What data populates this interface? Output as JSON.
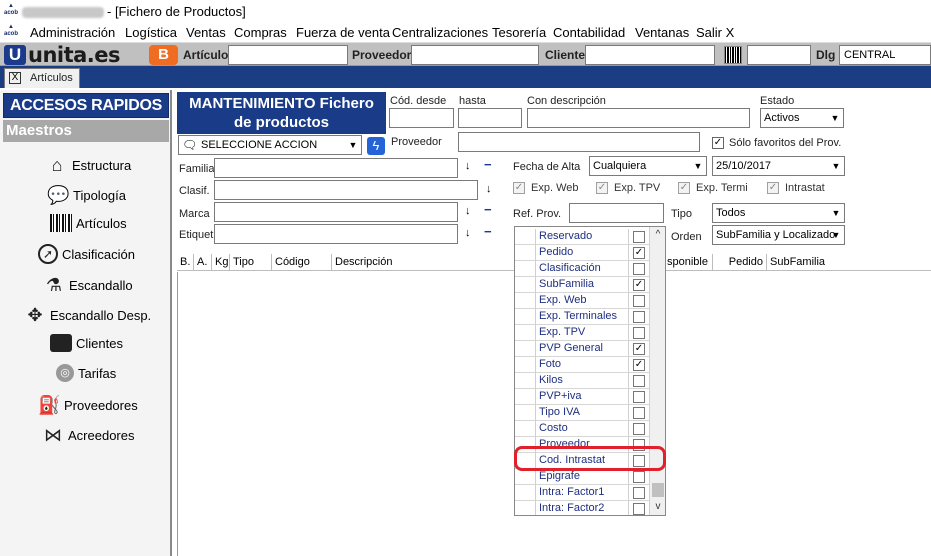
{
  "window": {
    "title": "- [Fichero de Productos]",
    "icon_text": "acob"
  },
  "menu": [
    "Administración",
    "Logística",
    "Ventas",
    "Compras",
    "Fuerza de venta",
    "Centralizaciones",
    "Tesorería",
    "Contabilidad",
    "Ventanas",
    "Salir X"
  ],
  "toolbar": {
    "logo": "unita.es",
    "logo_u": "U",
    "logo_b": "B",
    "articulo_label": "Artículo",
    "articulo_value": "",
    "proveedor_label": "Proveedor",
    "proveedor_value": "",
    "cliente_label": "Cliente",
    "cliente_value": "",
    "barcode_value": "",
    "dlg_label": "Dlg",
    "dlg_value": "CENTRAL"
  },
  "tabs": [
    {
      "label": "Artículos",
      "close": "X"
    }
  ],
  "sidebar": {
    "header": "ACCESOS RAPIDOS",
    "section": "Maestros",
    "items": [
      {
        "label": "Estructura",
        "icon": "house-icon"
      },
      {
        "label": "Tipología",
        "icon": "speech-bubble-icon"
      },
      {
        "label": "Artículos",
        "icon": "barcode-icon"
      },
      {
        "label": "Clasificación",
        "icon": "compass-icon"
      },
      {
        "label": "Escandallo",
        "icon": "flask-icon"
      },
      {
        "label": "Escandallo Desp.",
        "icon": "puzzle-icon"
      },
      {
        "label": "Clientes",
        "icon": "briefcase-icon"
      },
      {
        "label": "Tarifas",
        "icon": "tariff-icon"
      },
      {
        "label": "Proveedores",
        "icon": "fuel-pump-icon"
      },
      {
        "label": "Acreedores",
        "icon": "bow-tie-icon"
      }
    ]
  },
  "form": {
    "title_line1": "MANTENIMIENTO Fichero",
    "title_line2": "de productos",
    "cod_desde_label": "Cód. desde",
    "cod_desde_value": "",
    "hasta_label": "hasta",
    "hasta_value": "",
    "con_descripcion_label": "Con descripción",
    "con_descripcion_value": "",
    "estado_label": "Estado",
    "estado_value": "Activos",
    "accion_value": "SELECCIONE ACCION",
    "proveedor_label": "Proveedor",
    "proveedor_value": "",
    "solo_favoritos_label": "Sólo favoritos del Prov.",
    "solo_favoritos_checked": "✓",
    "familia_label": "Familia",
    "clasif_label": "Clasif.",
    "marca_label": "Marca",
    "etiquet_label": "Etiquet.",
    "fecha_alta_label": "Fecha de Alta",
    "fecha_alta_value": "Cualquiera",
    "fecha_value": "25/10/2017",
    "exp_web_label": "Exp. Web",
    "exp_tpv_label": "Exp. TPV",
    "exp_termi_label": "Exp. Termi",
    "intrastat_label": "Intrastat",
    "check_mark": "✓",
    "ref_prov_label": "Ref. Prov.",
    "ref_prov_value": "",
    "tipo_label": "Tipo",
    "tipo_value": "Todos",
    "orden_label": "Orden",
    "orden_value": "SubFamilia y Localizado"
  },
  "grid": {
    "columns_left": [
      "B.",
      "A.",
      "Kg",
      "Tipo",
      "Código",
      "Descripción"
    ],
    "columns_right": [
      "sponible",
      "Pedido",
      "SubFamilia"
    ]
  },
  "column_picker": {
    "rows": [
      {
        "label": "Reservado",
        "checked": ""
      },
      {
        "label": "Pedido",
        "checked": "✓"
      },
      {
        "label": "Clasificación",
        "checked": ""
      },
      {
        "label": "SubFamilia",
        "checked": "✓"
      },
      {
        "label": "Exp. Web",
        "checked": ""
      },
      {
        "label": "Exp. Terminales",
        "checked": ""
      },
      {
        "label": "Exp. TPV",
        "checked": ""
      },
      {
        "label": "PVP General",
        "checked": "✓"
      },
      {
        "label": "Foto",
        "checked": "✓"
      },
      {
        "label": "Kilos",
        "checked": ""
      },
      {
        "label": "PVP+iva",
        "checked": ""
      },
      {
        "label": "Tipo IVA",
        "checked": ""
      },
      {
        "label": "Costo",
        "checked": ""
      },
      {
        "label": "Proveedor",
        "checked": ""
      },
      {
        "label": "Cod. Intrastat",
        "checked": ""
      },
      {
        "label": "Epigrafe",
        "checked": ""
      },
      {
        "label": "Intra: Factor1",
        "checked": ""
      },
      {
        "label": "Intra: Factor2",
        "checked": ""
      }
    ],
    "highlight_color": "#e0202a"
  }
}
